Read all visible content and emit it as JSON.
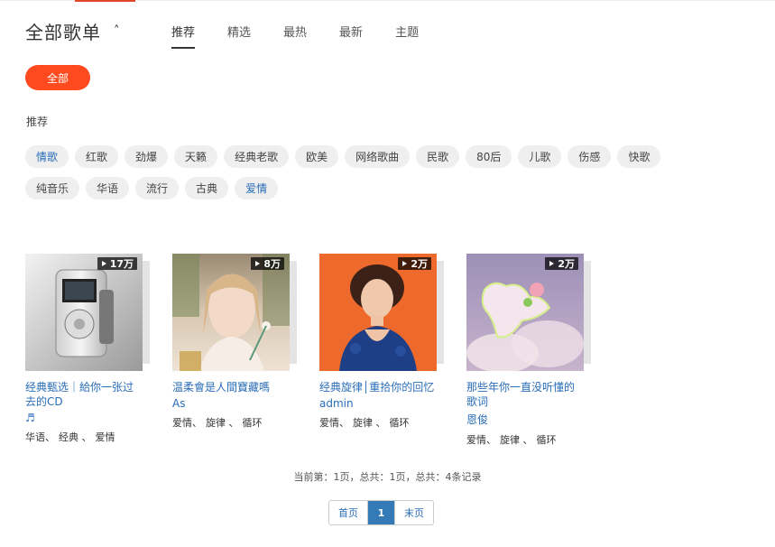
{
  "header": {
    "title": "全部歌单",
    "tabs": [
      {
        "label": "推荐",
        "active": true
      },
      {
        "label": "精选"
      },
      {
        "label": "最热"
      },
      {
        "label": "最新"
      },
      {
        "label": "主题"
      }
    ]
  },
  "filter": {
    "all_button": "全部",
    "section_label": "推荐",
    "tags_row1": [
      "情歌",
      "红歌",
      "劲爆",
      "天籁",
      "经典老歌",
      "欧美",
      "网络歌曲",
      "民歌",
      "80后",
      "儿歌",
      "伤感",
      "快歌"
    ],
    "tags_row2": [
      "纯音乐",
      "华语",
      "流行",
      "古典",
      "爱情"
    ]
  },
  "playlists": [
    {
      "title": "经典甄选｜給你一张过去的CD",
      "author": "♬",
      "play_count": "17万",
      "tags": [
        "华语、",
        "经典 、",
        "爱情"
      ],
      "cover_theme": "mp3-player"
    },
    {
      "title": "温柔會是人間寶藏嗎",
      "author": "As",
      "play_count": "8万",
      "tags": [
        "爱情、",
        "旋律 、",
        "循环"
      ],
      "cover_theme": "girl-with-flower"
    },
    {
      "title": "经典旋律│重拾你的回忆",
      "author": "admin",
      "play_count": "2万",
      "tags": [
        "爱情、",
        "旋律 、",
        "循环"
      ],
      "cover_theme": "singer-orange-bg"
    },
    {
      "title": "那些年你一直没听懂的歌词",
      "author": "恩俊",
      "play_count": "2万",
      "tags": [
        "爱情、",
        "旋律 、",
        "循环"
      ],
      "cover_theme": "unicorn-cloud"
    }
  ],
  "pagination": {
    "summary": "当前第：1页，总共：1页，总共：4条记录",
    "first": "首页",
    "current": "1",
    "last": "末页"
  },
  "colors": {
    "accent": "#ff4a1f",
    "link": "#2a6db8",
    "tag_bg": "#efefef",
    "page_current": "#337ab7"
  }
}
